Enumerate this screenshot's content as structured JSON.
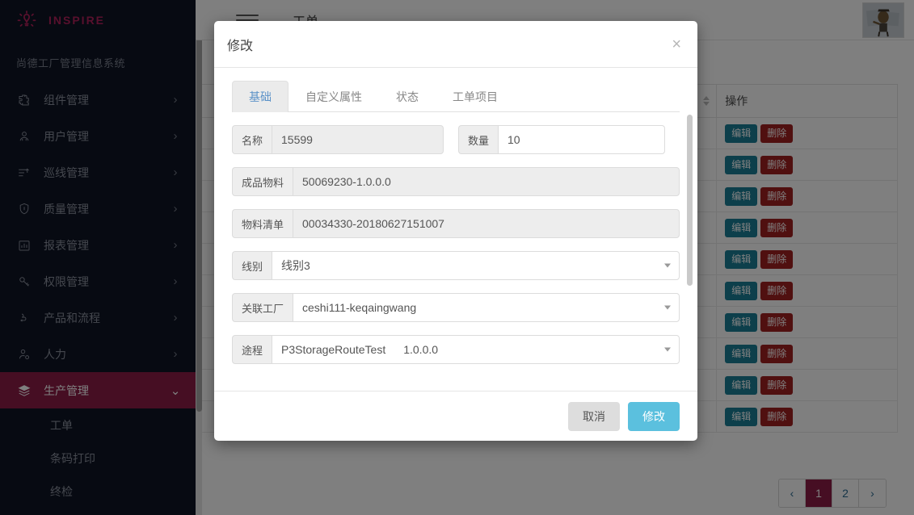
{
  "brand": {
    "name": "INSPIRE",
    "logo_icon": "lightbulb-icon",
    "accent_color": "#b0215a"
  },
  "sidebar": {
    "system_title": "尚德工厂管理信息系统",
    "items": [
      {
        "label": "组件管理",
        "icon": "puzzle-icon",
        "chevron": "›",
        "active": false
      },
      {
        "label": "用户管理",
        "icon": "users-icon",
        "chevron": "›",
        "active": false
      },
      {
        "label": "巡线管理",
        "icon": "list-check-icon",
        "chevron": "›",
        "active": false
      },
      {
        "label": "质量管理",
        "icon": "shield-icon",
        "chevron": "›",
        "active": false
      },
      {
        "label": "报表管理",
        "icon": "bar-chart-icon",
        "chevron": "›",
        "active": false
      },
      {
        "label": "权限管理",
        "icon": "key-icon",
        "chevron": "›",
        "active": false
      },
      {
        "label": "产品和流程",
        "icon": "flow-icon",
        "chevron": "›",
        "active": false
      },
      {
        "label": "人力",
        "icon": "person-gear-icon",
        "chevron": "›",
        "active": false
      },
      {
        "label": "生产管理",
        "icon": "layers-icon",
        "chevron": "⌄",
        "active": true
      }
    ],
    "sub_items": [
      {
        "label": "工单"
      },
      {
        "label": "条码打印"
      },
      {
        "label": "终检"
      }
    ],
    "active_color": "#8c1c46"
  },
  "topbar": {
    "menu_icon": "hamburger-icon",
    "page_title": "工单",
    "avatar_alt": "user-avatar"
  },
  "table": {
    "columns": [
      {
        "label": "",
        "sortable": true
      },
      {
        "label": "操作",
        "sortable": false
      }
    ],
    "action_labels": {
      "edit": "编辑",
      "delete": "删除"
    },
    "row_count": 10,
    "edit_color": "#1b7e96",
    "delete_color": "#a02020"
  },
  "pagination": {
    "prev": "‹",
    "next": "›",
    "pages": [
      "1",
      "2"
    ],
    "current": "1"
  },
  "modal": {
    "title": "修改",
    "close_icon": "close-icon",
    "tabs": [
      {
        "label": "基础",
        "active": true
      },
      {
        "label": "自定义属性",
        "active": false
      },
      {
        "label": "状态",
        "active": false
      },
      {
        "label": "工单项目",
        "active": false
      }
    ],
    "fields": {
      "name": {
        "label": "名称",
        "value": "15599",
        "disabled": true
      },
      "quantity": {
        "label": "数量",
        "value": "10",
        "disabled": false
      },
      "finished_material": {
        "label": "成品物料",
        "value": "50069230-1.0.0.0",
        "disabled": true
      },
      "bom": {
        "label": "物料清单",
        "value": "00034330-20180627151007",
        "disabled": true
      },
      "line": {
        "label": "线别",
        "value": "线别3",
        "type": "select"
      },
      "factory": {
        "label": "关联工厂",
        "value": "ceshi111-keqaingwang",
        "type": "select"
      },
      "route": {
        "label": "途程",
        "value": "P3StorageRouteTest",
        "version": "1.0.0.0",
        "type": "select"
      }
    },
    "footer": {
      "cancel": "取消",
      "submit": "修改",
      "submit_color": "#5bc0de"
    }
  }
}
